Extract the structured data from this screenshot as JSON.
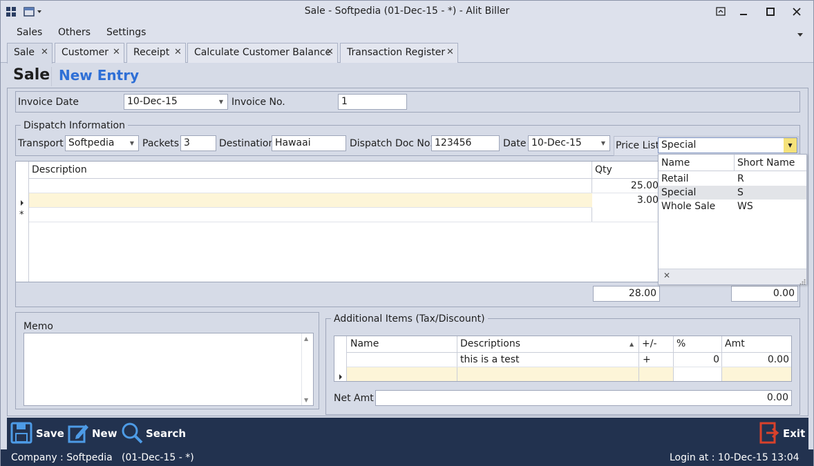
{
  "window": {
    "title": "Sale - Softpedia (01-Dec-15 - *) - Alit Biller"
  },
  "menu": {
    "items": [
      "Sales",
      "Others",
      "Settings"
    ]
  },
  "tabs": [
    "Sale",
    "Customer",
    "Receipt",
    "Calculate Customer Balance",
    "Transaction Register"
  ],
  "header": {
    "title": "Sale",
    "subtitle": "New Entry"
  },
  "invoice": {
    "date_label": "Invoice Date",
    "date_value": "10-Dec-15",
    "no_label": "Invoice No.",
    "no_value": "1"
  },
  "dispatch": {
    "group_label": "Dispatch Information",
    "transport_label": "Transport",
    "transport_value": "Softpedia",
    "packets_label": "Packets",
    "packets_value": "3",
    "destination_label": "Destination",
    "destination_value": "Hawaai",
    "doc_label": "Dispatch Doc No.",
    "doc_value": "123456",
    "date_label": "Date",
    "date_value": "10-Dec-15"
  },
  "pricelist": {
    "label": "Price List",
    "value": "Special",
    "headers": [
      "Name",
      "Short Name"
    ],
    "rows": [
      [
        "Retail",
        "R"
      ],
      [
        "Special",
        "S"
      ],
      [
        "Whole Sale",
        "WS"
      ]
    ]
  },
  "items": {
    "headers": [
      "Description",
      "Qty"
    ],
    "rows": [
      {
        "description": "",
        "qty": "25.00"
      },
      {
        "description": "",
        "qty": "3.00"
      }
    ],
    "total_qty": "28.00",
    "total_amt": "0.00"
  },
  "memo": {
    "label": "Memo"
  },
  "additional": {
    "group_label": "Additional Items (Tax/Discount)",
    "headers": [
      "Name",
      "Descriptions",
      "+/-",
      "%",
      "Amt"
    ],
    "rows": [
      {
        "name": "",
        "desc": "this is a test",
        "sign": "+",
        "pct": "0",
        "amt": "0.00"
      }
    ],
    "net_label": "Net Amt",
    "net_value": "0.00"
  },
  "toolbar": {
    "save": "Save",
    "new": "New",
    "search": "Search",
    "exit": "Exit"
  },
  "status": {
    "company": "Company : Softpedia   (01-Dec-15 - *)",
    "login": "Login at : 10-Dec-15 13:04"
  },
  "colors": {
    "accent": "#2e6fd6",
    "toolbar": "#22324f",
    "highlight_row": "#fdf5d8",
    "exit": "#d9412b"
  }
}
